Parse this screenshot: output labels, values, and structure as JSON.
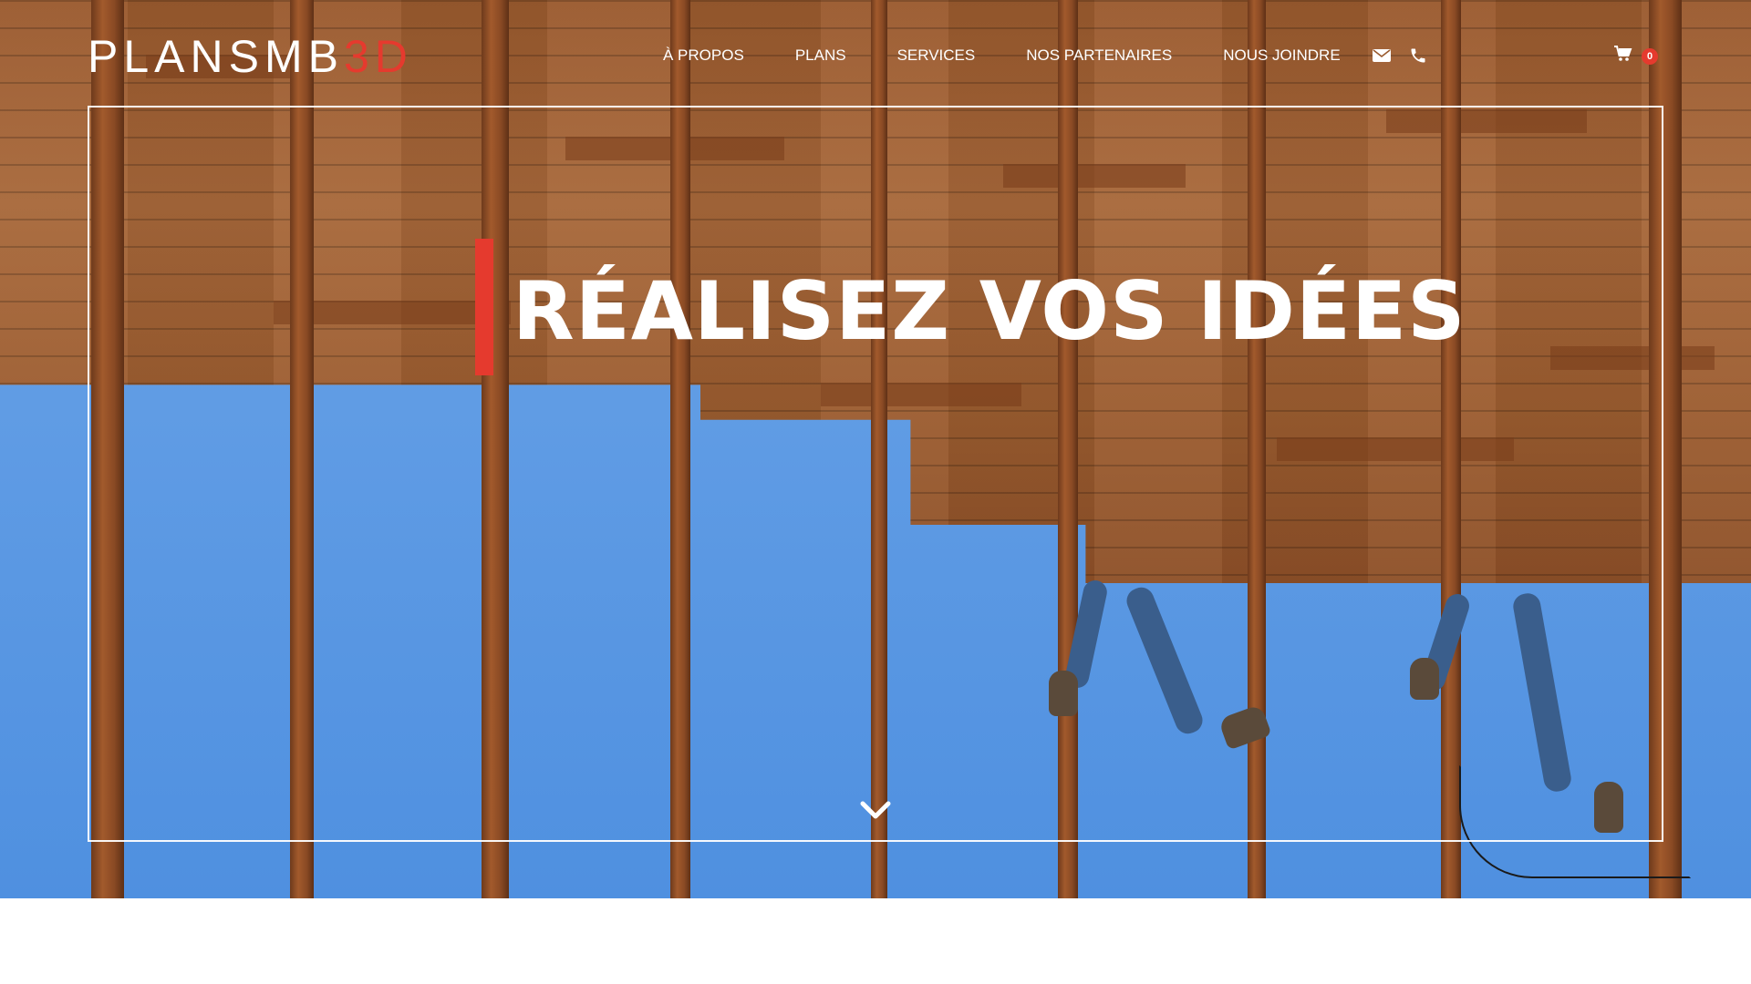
{
  "header": {
    "logo": {
      "part1": "PLANSMB",
      "part2": "3D"
    },
    "nav": [
      {
        "label": "À PROPOS"
      },
      {
        "label": "PLANS"
      },
      {
        "label": "SERVICES"
      },
      {
        "label": "NOS PARTENAIRES"
      },
      {
        "label": "NOUS JOINDRE"
      }
    ],
    "contact_icons": [
      "envelope-icon",
      "phone-icon"
    ],
    "cart": {
      "icon": "cart-icon",
      "count": "0"
    }
  },
  "hero": {
    "headline": "RÉALISEZ VOS IDÉES",
    "scroll_icon": "chevron-down-icon",
    "accent_color": "#e53a2e"
  }
}
